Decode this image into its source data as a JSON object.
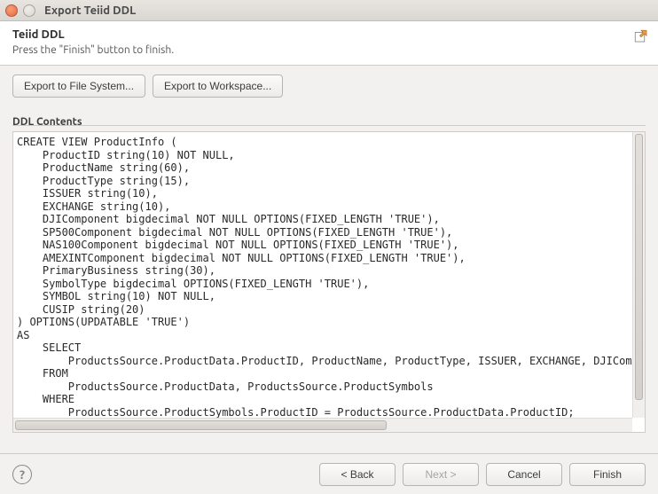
{
  "window": {
    "title": "Export Teiid DDL"
  },
  "header": {
    "title": "Teiid DDL",
    "subtitle": "Press the \"Finish\" button to finish."
  },
  "buttons": {
    "export_fs": "Export to File System...",
    "export_ws": "Export to Workspace..."
  },
  "section": {
    "ddl_label": "DDL Contents"
  },
  "ddl": "CREATE VIEW ProductInfo (\n    ProductID string(10) NOT NULL,\n    ProductName string(60),\n    ProductType string(15),\n    ISSUER string(10),\n    EXCHANGE string(10),\n    DJIComponent bigdecimal NOT NULL OPTIONS(FIXED_LENGTH 'TRUE'),\n    SP500Component bigdecimal NOT NULL OPTIONS(FIXED_LENGTH 'TRUE'),\n    NAS100Component bigdecimal NOT NULL OPTIONS(FIXED_LENGTH 'TRUE'),\n    AMEXINTComponent bigdecimal NOT NULL OPTIONS(FIXED_LENGTH 'TRUE'),\n    PrimaryBusiness string(30),\n    SymbolType bigdecimal OPTIONS(FIXED_LENGTH 'TRUE'),\n    SYMBOL string(10) NOT NULL,\n    CUSIP string(20)\n) OPTIONS(UPDATABLE 'TRUE')\nAS\n    SELECT\n        ProductsSource.ProductData.ProductID, ProductName, ProductType, ISSUER, EXCHANGE, DJIComponent\n    FROM\n        ProductsSource.ProductData, ProductsSource.ProductSymbols\n    WHERE\n        ProductsSource.ProductSymbols.ProductID = ProductsSource.ProductData.ProductID;",
  "footer": {
    "back": "< Back",
    "next": "Next >",
    "cancel": "Cancel",
    "finish": "Finish",
    "help": "?"
  }
}
